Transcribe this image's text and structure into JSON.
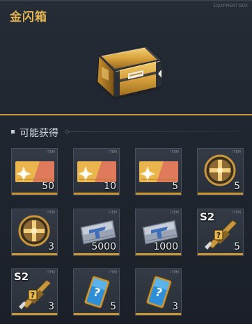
{
  "title": "金闪箱",
  "section": {
    "title": "可能获得"
  },
  "corner_tag": "EQUIPMENT BOX",
  "chest": {
    "icon": "gold-chest-icon",
    "accent": "#d6a13a"
  },
  "colors": {
    "gold": "#e2b453",
    "slot_bar": "#c79633",
    "background": "#20262f"
  },
  "rewards": [
    {
      "icon": "gold-ticket-icon",
      "count": "50"
    },
    {
      "icon": "gold-ticket-icon",
      "count": "10"
    },
    {
      "icon": "gold-ticket-icon",
      "count": "5"
    },
    {
      "icon": "gold-medal-icon",
      "count": "5"
    },
    {
      "icon": "gold-medal-icon",
      "count": "3"
    },
    {
      "icon": "silver-ticket-icon",
      "count": "5000"
    },
    {
      "icon": "silver-ticket-icon",
      "count": "1000"
    },
    {
      "icon": "mystery-rifle-icon",
      "badge": "S2",
      "count": "5"
    },
    {
      "icon": "mystery-rifle-icon",
      "badge": "S2",
      "count": "3"
    },
    {
      "icon": "mystery-card-icon",
      "count": "5"
    },
    {
      "icon": "mystery-card-icon",
      "count": "3"
    }
  ]
}
